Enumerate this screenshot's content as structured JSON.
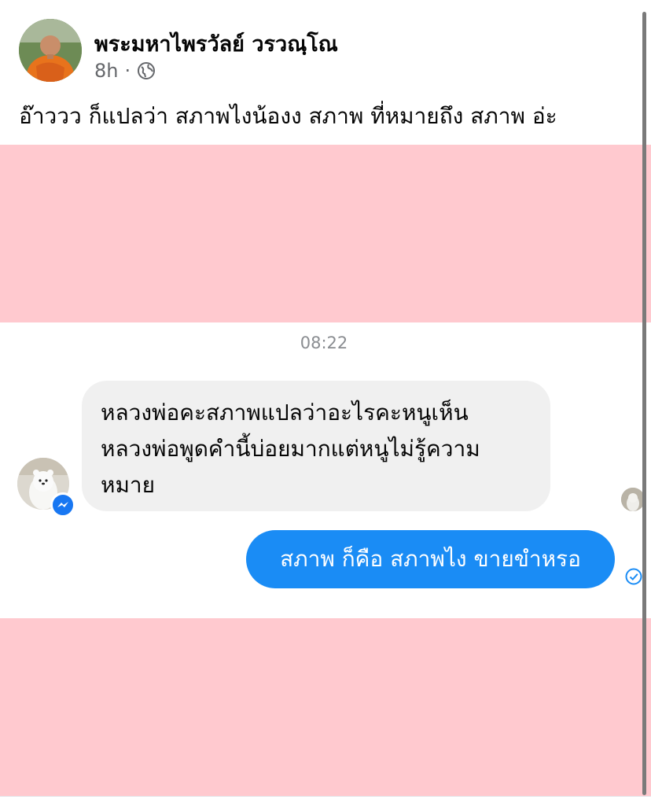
{
  "post": {
    "author_name": "พระมหาไพรวัลย์ วรวณฺโณ",
    "time": "8h",
    "separator": "·",
    "text": "อ๊าววว ก็แปลว่า สภาพไงน้องง สภาพ ที่หมายถึง สภาพ อ่ะ",
    "audience_icon": "globe-icon",
    "redaction_color": "#ffc9cf"
  },
  "chat": {
    "time": "08:22",
    "incoming_lines": [
      "หลวงพ่อคะสภาพแปลว่าอะไรคะหนูเห็น",
      "หลวงพ่อพูดคำนี้บ่อยมากแต่หนูไม่รู้ความ",
      "หมาย"
    ],
    "outgoing": "สภาพ ก็คือ สภาพไง ขายขำหรอ",
    "outgoing_color": "#1a8cf5",
    "badge_icon": "messenger-icon",
    "status_icon": "sent-check-icon"
  }
}
